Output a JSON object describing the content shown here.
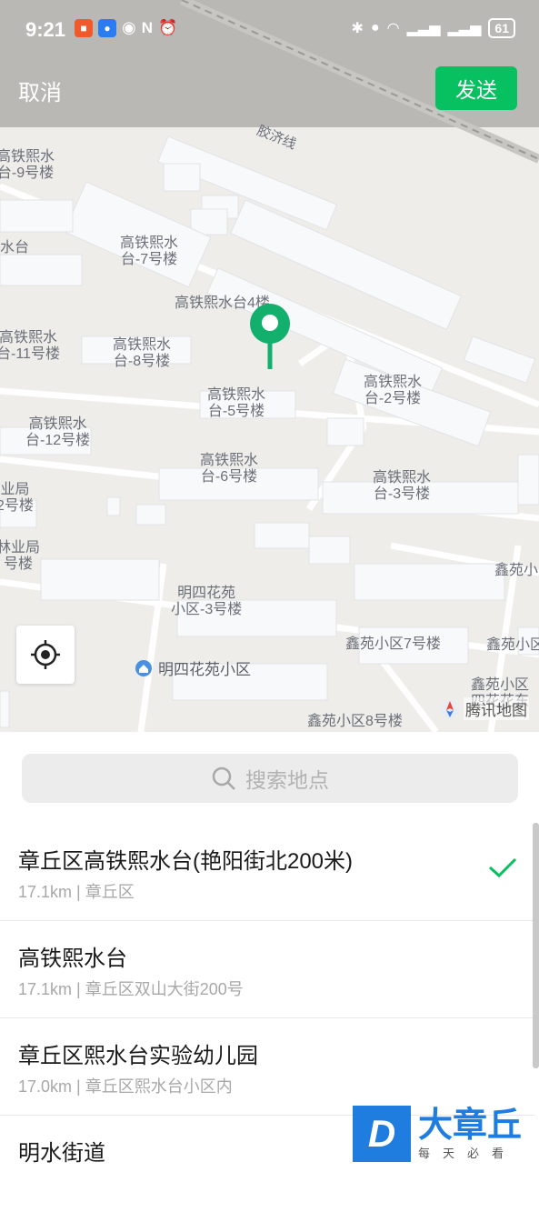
{
  "status_bar": {
    "time": "9:21",
    "battery": "61"
  },
  "header": {
    "cancel": "取消",
    "send": "发送"
  },
  "map": {
    "rail_label": "胶济线",
    "labels": [
      "高铁熙水\n台-9号楼",
      "水台",
      "高铁熙水\n台-7号楼",
      "高铁熙水台4楼",
      "高铁熙水\n台-11号楼",
      "高铁熙水\n台-8号楼",
      "高铁熙水\n台-2号楼",
      "高铁熙水\n台-5号楼",
      "高铁熙水\n台-12号楼",
      "高铁熙水\n台-6号楼",
      "高铁熙水\n台-3号楼",
      "业局\n2号楼",
      "林业局\n号楼",
      "明四花苑\n小区-3号楼",
      "鑫苑小",
      "鑫苑小区7号楼",
      "鑫苑小区",
      "鑫苑小区\n四花花东",
      "鑫苑小区8号楼"
    ],
    "poi": "明四花苑小区",
    "logo": "腾讯地图"
  },
  "search": {
    "placeholder": "搜索地点"
  },
  "results": [
    {
      "title": "章丘区高铁熙水台(艳阳街北200米)",
      "sub": "17.1km | 章丘区",
      "selected": true
    },
    {
      "title": "高铁熙水台",
      "sub": "17.1km | 章丘区双山大街200号",
      "selected": false
    },
    {
      "title": "章丘区熙水台实验幼儿园",
      "sub": "17.0km | 章丘区熙水台小区内",
      "selected": false
    },
    {
      "title": "明水街道",
      "sub": "",
      "selected": false
    }
  ],
  "watermark": {
    "mark": "D",
    "name": "大章丘",
    "slogan": "每天必看"
  },
  "colors": {
    "accent": "#07c160",
    "pin": "#12b06c"
  }
}
